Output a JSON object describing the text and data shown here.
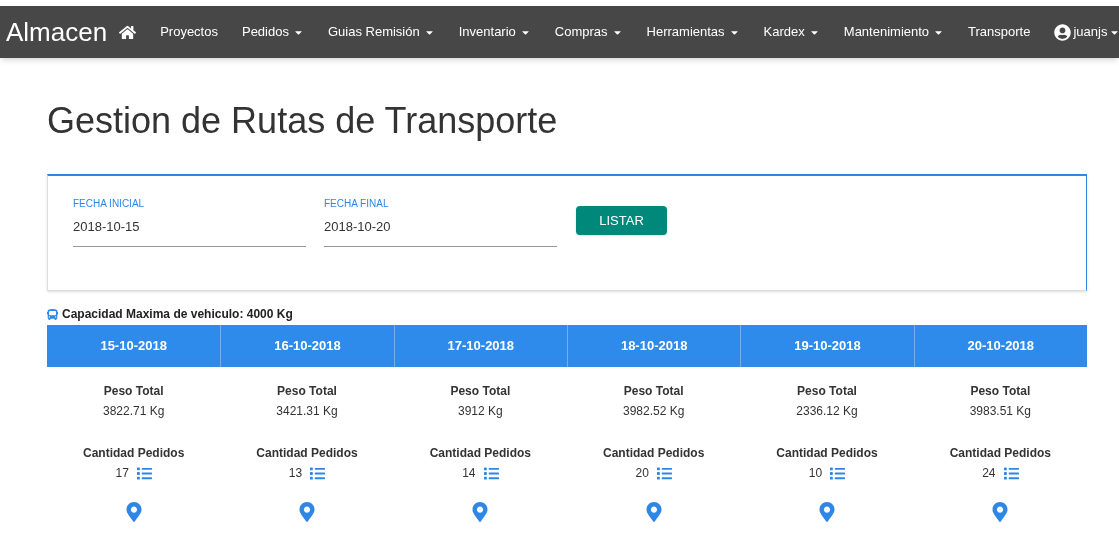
{
  "navbar": {
    "brand": "Almacen",
    "items": [
      {
        "kind": "home"
      },
      {
        "kind": "link",
        "label": "Proyectos",
        "dropdown": false
      },
      {
        "kind": "link",
        "label": "Pedidos",
        "dropdown": true
      },
      {
        "kind": "link",
        "label": "Guias Remisión",
        "dropdown": true
      },
      {
        "kind": "link",
        "label": "Inventario",
        "dropdown": true
      },
      {
        "kind": "link",
        "label": "Compras",
        "dropdown": true
      },
      {
        "kind": "link",
        "label": "Herramientas",
        "dropdown": true
      },
      {
        "kind": "link",
        "label": "Kardex",
        "dropdown": true
      },
      {
        "kind": "link",
        "label": "Mantenimiento",
        "dropdown": true
      },
      {
        "kind": "link",
        "label": "Transporte",
        "dropdown": false
      },
      {
        "kind": "user",
        "label": "juanjs",
        "dropdown": true
      }
    ]
  },
  "title": "Gestion de Rutas de Transporte",
  "filters": {
    "fields": [
      {
        "label": "FECHA INICIAL",
        "value": "2018-10-15"
      },
      {
        "label": "FECHA FINAL",
        "value": "2018-10-20"
      }
    ],
    "button": "LISTAR"
  },
  "capacity": "Capacidad Maxima de vehiculo: 4000 Kg",
  "days": [
    {
      "date": "15-10-2018",
      "weight_label": "Peso Total",
      "weight": "3822.71 Kg",
      "orders_label": "Cantidad Pedidos",
      "orders": "17"
    },
    {
      "date": "16-10-2018",
      "weight_label": "Peso Total",
      "weight": "3421.31 Kg",
      "orders_label": "Cantidad Pedidos",
      "orders": "13"
    },
    {
      "date": "17-10-2018",
      "weight_label": "Peso Total",
      "weight": "3912 Kg",
      "orders_label": "Cantidad Pedidos",
      "orders": "14"
    },
    {
      "date": "18-10-2018",
      "weight_label": "Peso Total",
      "weight": "3982.52 Kg",
      "orders_label": "Cantidad Pedidos",
      "orders": "20"
    },
    {
      "date": "19-10-2018",
      "weight_label": "Peso Total",
      "weight": "2336.12 Kg",
      "orders_label": "Cantidad Pedidos",
      "orders": "10"
    },
    {
      "date": "20-10-2018",
      "weight_label": "Peso Total",
      "weight": "3983.51 Kg",
      "orders_label": "Cantidad Pedidos",
      "orders": "24"
    }
  ]
}
